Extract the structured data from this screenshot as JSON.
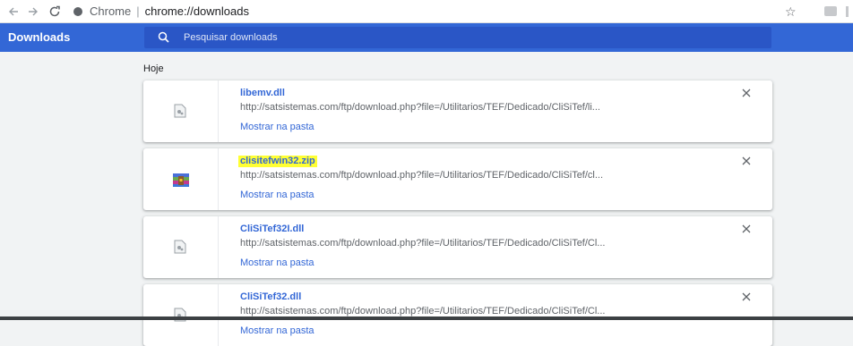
{
  "browser": {
    "back_icon": "back-arrow-icon",
    "forward_icon": "forward-arrow-icon",
    "reload_icon": "reload-icon",
    "tab_label": "Chrome",
    "separator": "|",
    "url": "chrome://downloads"
  },
  "toolbar": {
    "title": "Downloads",
    "search_placeholder": "Pesquisar downloads"
  },
  "date_header": "Hoje",
  "downloads": [
    {
      "name": "libemv.dll",
      "url": "http://satsistemas.com/ftp/download.php?file=/Utilitarios/TEF/Dedicado/CliSiTef/li...",
      "action": "Mostrar na pasta",
      "icon": "generic-file-icon",
      "highlighted": false
    },
    {
      "name": "clisitefwin32.zip",
      "url": "http://satsistemas.com/ftp/download.php?file=/Utilitarios/TEF/Dedicado/CliSiTef/cl...",
      "action": "Mostrar na pasta",
      "icon": "winrar-archive-icon",
      "highlighted": true
    },
    {
      "name": "CliSiTef32I.dll",
      "url": "http://satsistemas.com/ftp/download.php?file=/Utilitarios/TEF/Dedicado/CliSiTef/Cl...",
      "action": "Mostrar na pasta",
      "icon": "generic-file-icon",
      "highlighted": false
    },
    {
      "name": "CliSiTef32.dll",
      "url": "http://satsistemas.com/ftp/download.php?file=/Utilitarios/TEF/Dedicado/CliSiTef/Cl...",
      "action": "Mostrar na pasta",
      "icon": "generic-file-icon",
      "highlighted": false
    }
  ],
  "colors": {
    "accent": "#3367d6",
    "highlight": "#ffff33",
    "background": "#f1f3f4"
  }
}
